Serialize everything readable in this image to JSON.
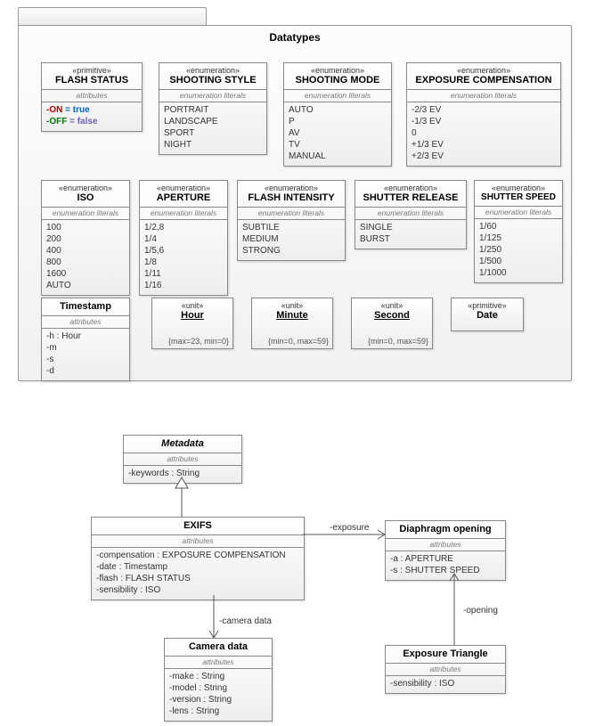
{
  "package": {
    "title": "Datatypes"
  },
  "stereos": {
    "primitive": "«primitive»",
    "enumeration": "«enumeration»",
    "unit": "«unit»"
  },
  "section_labels": {
    "attributes": "attributes",
    "enum_literals": "enumeration literals"
  },
  "boxes": {
    "flash_status": {
      "name": "FLASH STATUS",
      "rows": {
        "r0a": "-ON",
        "r0b": " = true",
        "r1a": "-OFF",
        "r1b": " = false"
      }
    },
    "shooting_style": {
      "name": "SHOOTING STYLE",
      "rows": {
        "r0": "PORTRAIT",
        "r1": "LANDSCAPE",
        "r2": "SPORT",
        "r3": "NIGHT"
      }
    },
    "shooting_mode": {
      "name": "SHOOTING MODE",
      "rows": {
        "r0": "AUTO",
        "r1": "P",
        "r2": "AV",
        "r3": "TV",
        "r4": "MANUAL"
      }
    },
    "exposure_comp": {
      "name": "EXPOSURE COMPENSATION",
      "rows": {
        "r0": "-2/3 EV",
        "r1": "-1/3 EV",
        "r2": "0",
        "r3": "+1/3 EV",
        "r4": "+2/3 EV"
      }
    },
    "iso": {
      "name": "ISO",
      "rows": {
        "r0": "100",
        "r1": "200",
        "r2": "400",
        "r3": "800",
        "r4": "1600",
        "r5": "AUTO"
      }
    },
    "aperture": {
      "name": "APERTURE",
      "rows": {
        "r0": "1/2,8",
        "r1": "1/4",
        "r2": "1/5,6",
        "r3": "1/8",
        "r4": "1/11",
        "r5": "1/16"
      }
    },
    "flash_intensity": {
      "name": "FLASH INTENSITY",
      "rows": {
        "r0": "SUBTILE",
        "r1": "MEDIUM",
        "r2": "STRONG"
      }
    },
    "shutter_release": {
      "name": "SHUTTER RELEASE",
      "rows": {
        "r0": "SINGLE",
        "r1": "BURST"
      }
    },
    "shutter_speed": {
      "name": "SHUTTER SPEED",
      "rows": {
        "r0": "1/60",
        "r1": "1/125",
        "r2": "1/250",
        "r3": "1/500",
        "r4": "1/1000"
      }
    },
    "timestamp": {
      "name": "Timestamp",
      "rows": {
        "r0": "-h : Hour",
        "r1": "-m",
        "r2": "-s",
        "r3": "-d"
      }
    },
    "hour": {
      "name": "Hour",
      "constraint": "{max=23,\nmin=0}"
    },
    "minute": {
      "name": "Minute",
      "constraint": "{min=0,\nmax=59}"
    },
    "second": {
      "name": "Second",
      "constraint": "{min=0,\nmax=59}"
    },
    "date": {
      "name": "Date"
    },
    "metadata": {
      "name": "Metadata",
      "rows": {
        "r0": "-keywords : String"
      }
    },
    "exifs": {
      "name": "EXIFS",
      "rows": {
        "r0": "-compensation : EXPOSURE COMPENSATION",
        "r1": "-date : Timestamp",
        "r2": "-flash : FLASH STATUS",
        "r3": "-sensibility : ISO"
      }
    },
    "diaphragm": {
      "name": "Diaphragm opening",
      "rows": {
        "r0": "-a : APERTURE",
        "r1": "-s : SHUTTER SPEED"
      }
    },
    "camera": {
      "name": "Camera data",
      "rows": {
        "r0": "-make : String",
        "r1": "-model : String",
        "r2": "-version : String",
        "r3": "-lens : String"
      }
    },
    "triangle": {
      "name": "Exposure Triangle",
      "rows": {
        "r0": "-sensibility : ISO"
      }
    }
  },
  "rel_labels": {
    "exposure": "-exposure",
    "camera": "-camera data",
    "opening": "-opening"
  }
}
